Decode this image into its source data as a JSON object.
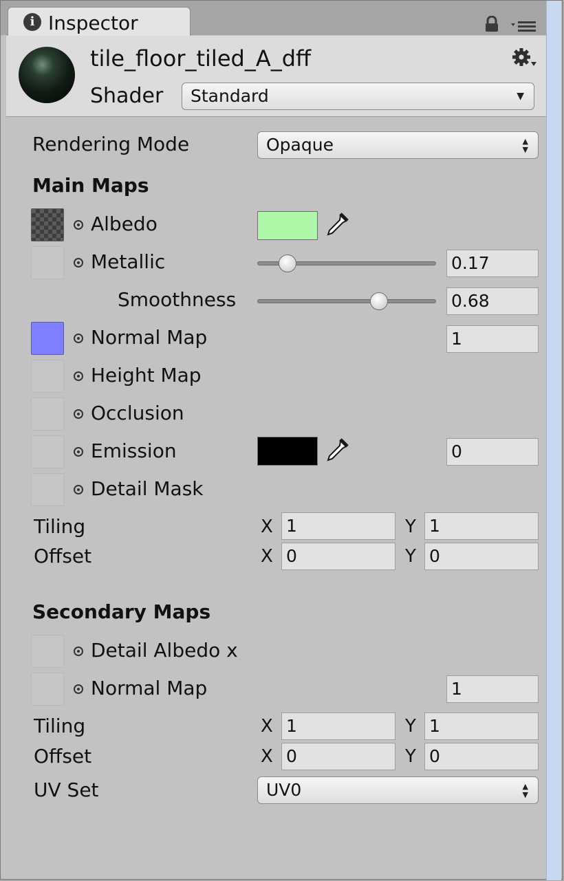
{
  "tab": {
    "title": "Inspector",
    "info_icon": "i"
  },
  "material": {
    "name": "tile_floor_tiled_A_dff"
  },
  "shader": {
    "label": "Shader",
    "value": "Standard"
  },
  "rendering_mode": {
    "label": "Rendering Mode",
    "value": "Opaque"
  },
  "main_maps": {
    "title": "Main Maps",
    "albedo": {
      "label": "Albedo",
      "color": "#aef7a8"
    },
    "metallic": {
      "label": "Metallic",
      "value": "0.17",
      "slider": 0.17
    },
    "smoothness": {
      "label": "Smoothness",
      "value": "0.68",
      "slider": 0.68
    },
    "normal_map": {
      "label": "Normal Map",
      "value": "1"
    },
    "height_map": {
      "label": "Height Map"
    },
    "occlusion": {
      "label": "Occlusion"
    },
    "emission": {
      "label": "Emission",
      "value": "0",
      "color": "#000000"
    },
    "detail_mask": {
      "label": "Detail Mask"
    },
    "tiling": {
      "label": "Tiling",
      "x_label": "X",
      "x": "1",
      "y_label": "Y",
      "y": "1"
    },
    "offset": {
      "label": "Offset",
      "x_label": "X",
      "x": "0",
      "y_label": "Y",
      "y": "0"
    }
  },
  "secondary_maps": {
    "title": "Secondary Maps",
    "detail_albedo": {
      "label": "Detail Albedo x"
    },
    "normal_map": {
      "label": "Normal Map",
      "value": "1"
    },
    "tiling": {
      "label": "Tiling",
      "x_label": "X",
      "x": "1",
      "y_label": "Y",
      "y": "1"
    },
    "offset": {
      "label": "Offset",
      "x_label": "X",
      "x": "0",
      "y_label": "Y",
      "y": "0"
    },
    "uv_set": {
      "label": "UV Set",
      "value": "UV0"
    }
  },
  "icons": {
    "lock": "lock-icon",
    "menu": "menu-icon",
    "gear": "gear-icon",
    "dropdown_arrow": "▼",
    "stepper_arrow": "▲▼"
  }
}
